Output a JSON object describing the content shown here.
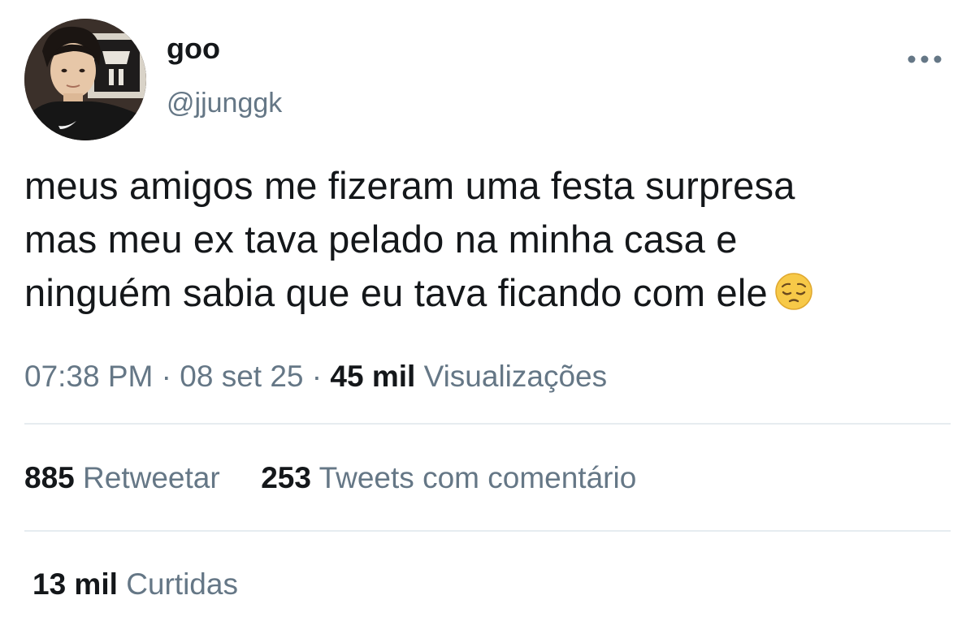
{
  "author": {
    "display_name": "goo",
    "handle": "@jjunggk",
    "avatar_icon": "profile-photo"
  },
  "menu": {
    "icon": "more-horizontal-icon"
  },
  "tweet": {
    "lines": [
      "meus amigos me fizeram uma festa surpresa",
      "mas meu ex tava pelado na minha casa e",
      "ninguém sabia que eu tava ficando com ele"
    ],
    "emoji": "pensive-face-emoji"
  },
  "meta": {
    "time": "07:38 PM",
    "separator": "·",
    "date": "08 set 25",
    "views_count": "45 mil",
    "views_label": "Visualizações"
  },
  "stats": {
    "retweets_count": "885",
    "retweets_label": "Retweetar",
    "quotes_count": "253",
    "quotes_label": "Tweets com comentário"
  },
  "likes": {
    "count": "13 mil",
    "label": "Curtidas"
  },
  "colors": {
    "text_primary": "#14171a",
    "text_secondary": "#657786",
    "divider": "#e6ecf0",
    "background": "#ffffff"
  }
}
